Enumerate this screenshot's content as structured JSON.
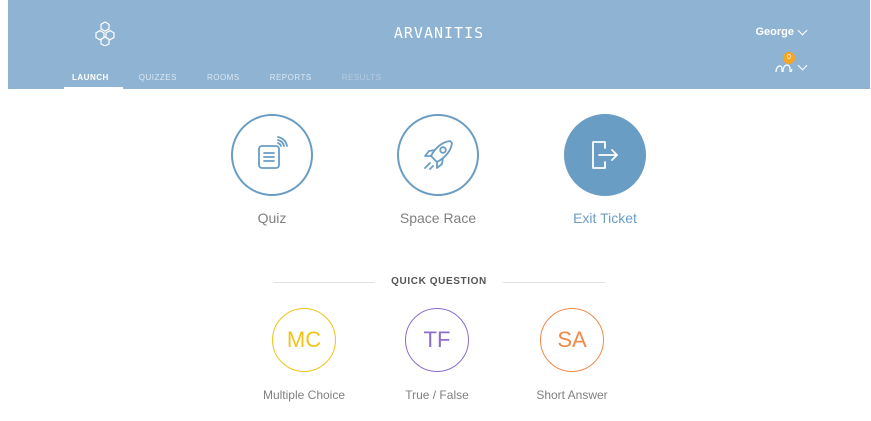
{
  "header": {
    "room_name": "ARVANITIS",
    "user_name": "George",
    "notification_count": "0",
    "logo_icon": "hexagon-cluster-icon",
    "color": "#8fb3d3"
  },
  "tabs": [
    {
      "label": "LAUNCH",
      "state": "active"
    },
    {
      "label": "QUIZZES",
      "state": "normal"
    },
    {
      "label": "ROOMS",
      "state": "normal"
    },
    {
      "label": "REPORTS",
      "state": "normal"
    },
    {
      "label": "RESULTS",
      "state": "disabled"
    }
  ],
  "launch": [
    {
      "label": "Quiz",
      "icon": "quiz-document-icon"
    },
    {
      "label": "Space Race",
      "icon": "rocket-icon"
    },
    {
      "label": "Exit Ticket",
      "icon": "exit-door-icon"
    }
  ],
  "quick_question": {
    "title": "QUICK QUESTION",
    "items": [
      {
        "abbr": "MC",
        "label": "Multiple Choice",
        "color": "#f0c419"
      },
      {
        "abbr": "TF",
        "label": "True / False",
        "color": "#8c6fc8"
      },
      {
        "abbr": "SA",
        "label": "Short Answer",
        "color": "#f08a4b"
      }
    ]
  },
  "colors": {
    "accent": "#6a9dc4"
  }
}
